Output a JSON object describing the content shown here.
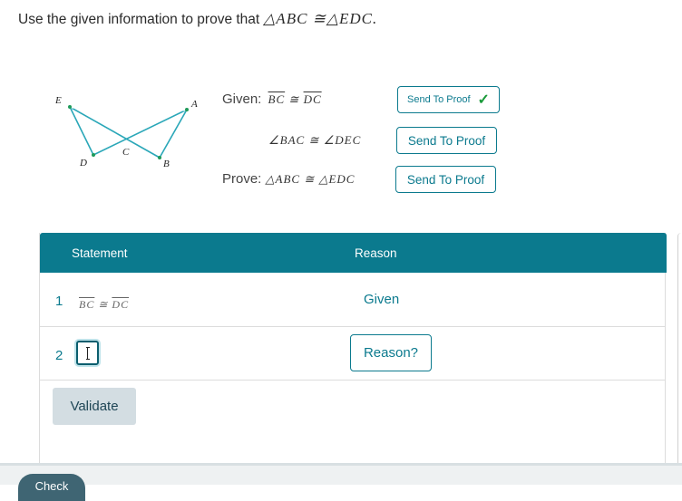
{
  "prompt": {
    "text": "Use the given information to prove that",
    "math": "△ABC ≅△EDC."
  },
  "figure": {
    "points": [
      "E",
      "A",
      "C",
      "D",
      "B"
    ],
    "line_color": "#2aa7b8"
  },
  "given": {
    "label": "Given:",
    "stmt1_seg1": "BC",
    "stmt1_op": "≅",
    "stmt1_seg2": "DC",
    "stmt2": "∠BAC ≅ ∠DEC",
    "prove_label": "Prove:",
    "prove_stmt": "△ABC ≅ △EDC"
  },
  "send_buttons": {
    "label1": "Send To Proof",
    "label2": "Send To Proof",
    "label3": "Send To Proof",
    "check": "✓"
  },
  "table": {
    "header_statement": "Statement",
    "header_reason": "Reason",
    "header_color": "#0b7a8e",
    "rows": [
      {
        "num": "1",
        "seg1": "BC",
        "op": "≅",
        "seg2": "DC",
        "reason": "Given"
      },
      {
        "num": "2",
        "input_value": "",
        "reason_button": "Reason?"
      }
    ]
  },
  "validate_label": "Validate",
  "check_label": "Check"
}
